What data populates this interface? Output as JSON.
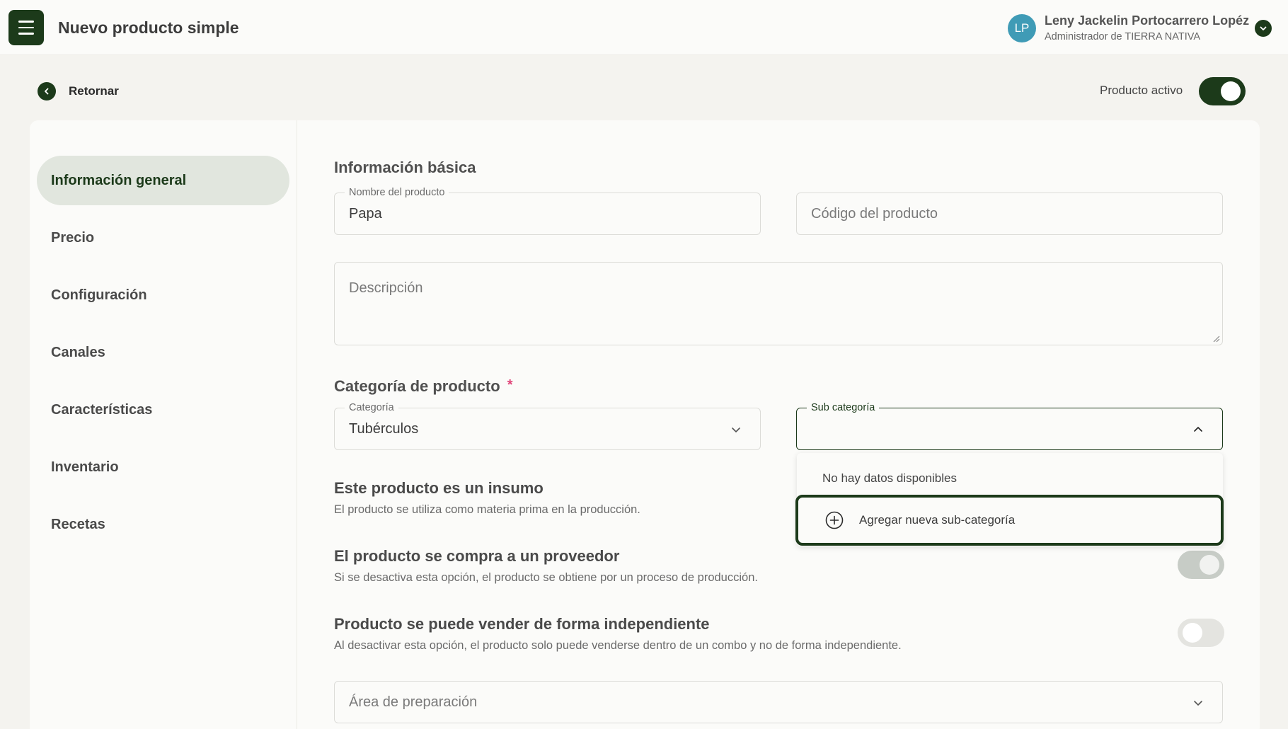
{
  "header": {
    "title": "Nuevo producto simple",
    "avatar_initials": "LP",
    "user_name": "Leny Jackelin Portocarrero Lopéz",
    "user_role": "Administrador de TIERRA NATIVA"
  },
  "subbar": {
    "back_label": "Retornar",
    "active_label": "Producto activo",
    "active_toggle": true
  },
  "sidebar": {
    "items": [
      {
        "label": "Información general",
        "active": true
      },
      {
        "label": "Precio"
      },
      {
        "label": "Configuración"
      },
      {
        "label": "Canales"
      },
      {
        "label": "Características"
      },
      {
        "label": "Inventario"
      },
      {
        "label": "Recetas"
      }
    ]
  },
  "form": {
    "basic_title": "Información básica",
    "product_name_label": "Nombre del producto",
    "product_name_value": "Papa",
    "product_code_placeholder": "Código del producto",
    "description_placeholder": "Descripción",
    "category_title": "Categoría de producto",
    "required_mark": "*",
    "category_label": "Categoría",
    "category_value": "Tubérculos",
    "subcategory_label": "Sub categoría",
    "subcategory_value": "",
    "insumo_title": "Este producto es un insumo",
    "insumo_desc": "El producto se utiliza como materia prima en la producción.",
    "proveedor_title": "El producto se compra a un proveedor",
    "proveedor_desc": "Si se desactiva esta opción, el producto se obtiene por un proceso de producción.",
    "proveedor_toggle": true,
    "independiente_title": "Producto se puede vender de forma independiente",
    "independiente_desc": "Al desactivar esta opción, el producto solo puede venderse dentro de un combo y no de forma independiente.",
    "independiente_toggle": false,
    "area_placeholder": "Área de preparación"
  },
  "dropdown": {
    "empty_text": "No hay datos disponibles",
    "add_label": "Agregar nueva sub-categoría"
  },
  "colors": {
    "primary": "#1c3a1a",
    "avatar": "#3f9bb6",
    "required": "#e0467a",
    "active_nav_bg": "#e1e6de"
  },
  "icons": [
    "menu-icon",
    "chevron-down-icon",
    "chevron-left-icon",
    "chevron-up-icon",
    "plus-circle-icon",
    "resize-grip-icon"
  ]
}
